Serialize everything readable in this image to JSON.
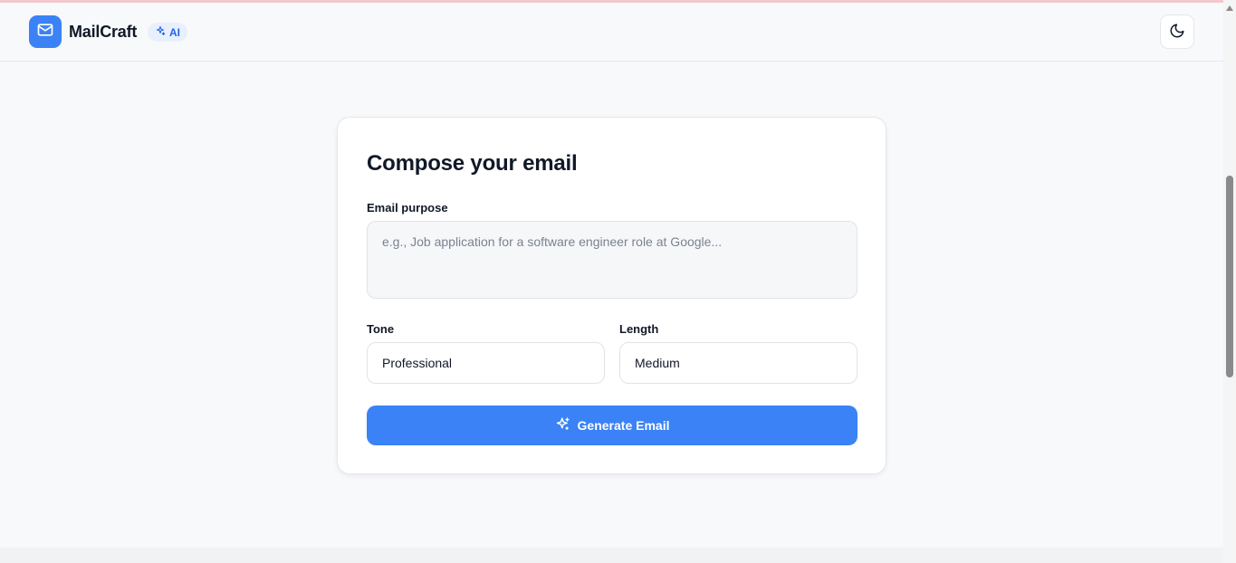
{
  "header": {
    "brand": "MailCraft",
    "badge": "AI",
    "logo_icon": "mail-icon",
    "theme_icon": "moon-icon"
  },
  "composer": {
    "title": "Compose your email",
    "purpose_label": "Email purpose",
    "purpose_value": "",
    "purpose_placeholder": "e.g., Job application for a software engineer role at Google...",
    "tone_label": "Tone",
    "tone_value": "Professional",
    "length_label": "Length",
    "length_value": "Medium",
    "generate_label": "Generate Email",
    "generate_icon": "sparkles-icon"
  },
  "colors": {
    "accent": "#3b82f6",
    "badge_bg": "#e8f0fe",
    "badge_text": "#2563eb",
    "page_bg": "#f8f9fb"
  }
}
